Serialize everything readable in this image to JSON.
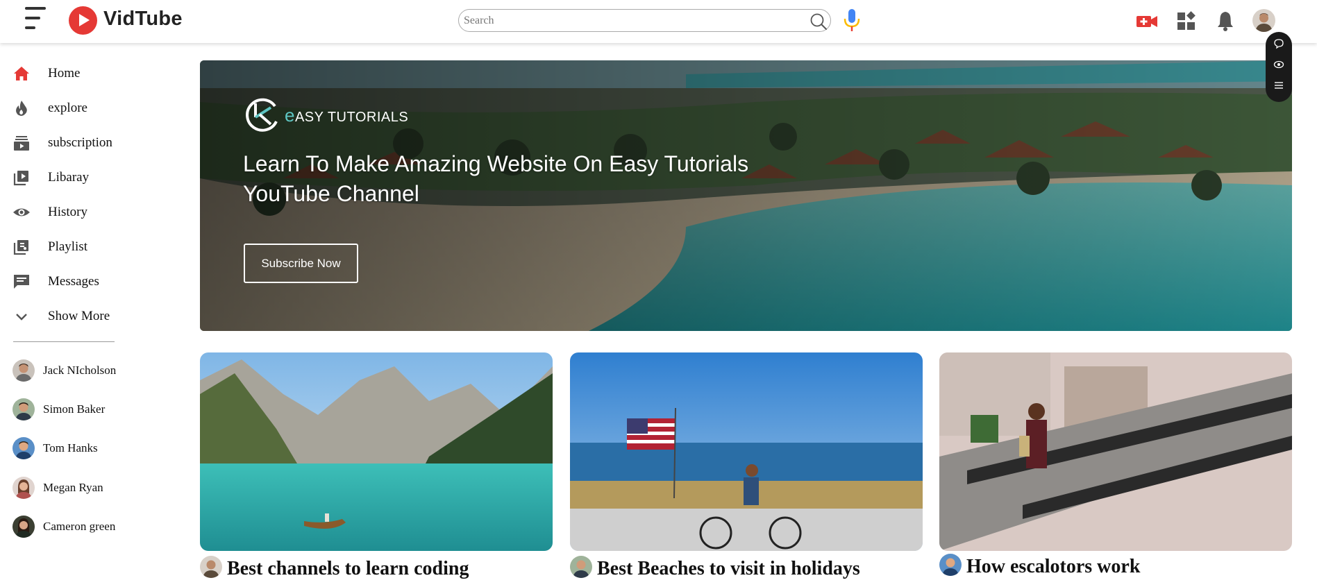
{
  "app": {
    "name": "VidTube"
  },
  "search": {
    "placeholder": "Search"
  },
  "sidebar": {
    "items": [
      {
        "label": "Home",
        "icon": "home-icon"
      },
      {
        "label": "explore",
        "icon": "flame-icon"
      },
      {
        "label": "subscription",
        "icon": "subscriptions-icon"
      },
      {
        "label": "Libaray",
        "icon": "library-icon"
      },
      {
        "label": "History",
        "icon": "eye-icon"
      },
      {
        "label": "Playlist",
        "icon": "playlist-icon"
      },
      {
        "label": "Messages",
        "icon": "message-icon"
      },
      {
        "label": "Show More",
        "icon": "chevron-down-icon"
      }
    ],
    "subscriptions": [
      {
        "name": "Jack NIcholson"
      },
      {
        "name": "Simon Baker"
      },
      {
        "name": "Tom Hanks"
      },
      {
        "name": "Megan Ryan"
      },
      {
        "name": "Cameron green"
      }
    ]
  },
  "banner": {
    "brand_e": "e",
    "brand_rest": "ASY TUTORIALS",
    "title": "Learn To Make Amazing Website On Easy Tutorials YouTube Channel",
    "button": "Subscribe Now"
  },
  "videos": [
    {
      "title": "Best channels to learn coding"
    },
    {
      "title": "Best Beaches to visit in holidays"
    },
    {
      "title": "How escalotors work"
    }
  ],
  "colors": {
    "accent": "#e53935",
    "home_icon": "#e53935",
    "sidebar_icon": "#555555",
    "brand_teal": "#5ec6c3"
  }
}
